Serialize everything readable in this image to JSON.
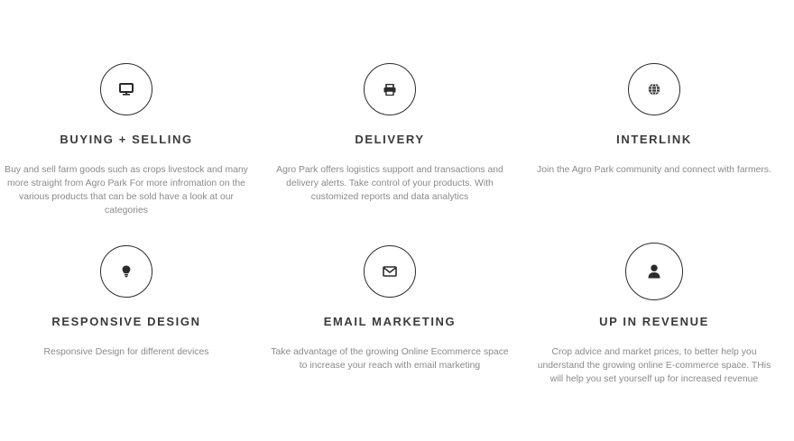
{
  "features": [
    {
      "icon": "monitor-icon",
      "title": "BUYING + SELLING",
      "description": "Buy and sell farm goods such as crops livestock and many more straight from Agro Park For more infromation on the various products that can be sold have a look at our categories"
    },
    {
      "icon": "printer-icon",
      "title": "DELIVERY",
      "description": "Agro Park offers logistics support and transactions and delivery alerts. Take control of your products. With customized reports and data analytics"
    },
    {
      "icon": "globe-icon",
      "title": "INTERLINK",
      "description": "Join the Agro Park community and connect with farmers."
    },
    {
      "icon": "lightbulb-icon",
      "title": "RESPONSIVE DESIGN",
      "description": "Responsive Design for different devices"
    },
    {
      "icon": "envelope-icon",
      "title": "EMAIL MARKETING",
      "description": "Take advantage of the growing Online Ecommerce space to increase your reach with email marketing"
    },
    {
      "icon": "user-icon",
      "title": "UP IN REVENUE",
      "description": "Crop advice and market prices, to better help you understand the growing online E-commerce space. THis will help you set yourself up for increased revenue"
    }
  ]
}
